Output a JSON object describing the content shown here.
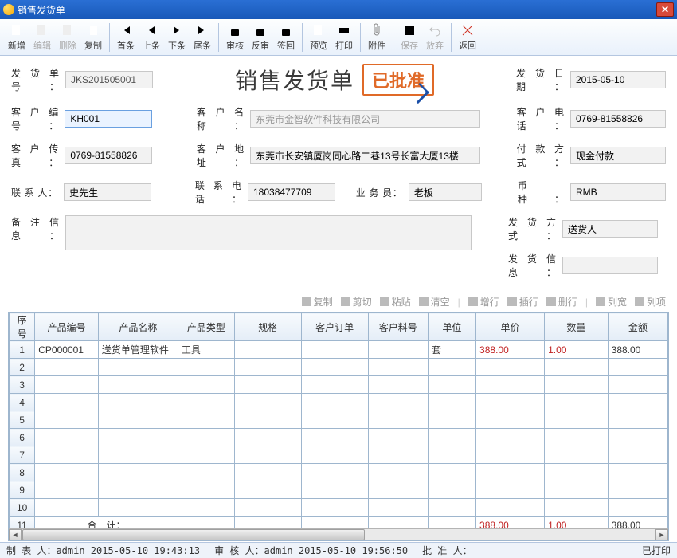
{
  "window": {
    "title": "销售发货单"
  },
  "toolbar": [
    {
      "name": "new",
      "label": "新增",
      "icon": "doc-plus",
      "color": "#4caf50"
    },
    {
      "name": "edit",
      "label": "编辑",
      "icon": "doc-pen",
      "color": "#b0a080",
      "dis": true
    },
    {
      "name": "delete",
      "label": "删除",
      "icon": "doc-x",
      "color": "#b0a080",
      "dis": true
    },
    {
      "name": "copy",
      "label": "复制",
      "icon": "docs",
      "color": "#b0a080"
    },
    {
      "sep": true
    },
    {
      "name": "first",
      "label": "首条",
      "icon": "first",
      "color": "#4a8fe0"
    },
    {
      "name": "prev",
      "label": "上条",
      "icon": "prev",
      "color": "#4a8fe0"
    },
    {
      "name": "next",
      "label": "下条",
      "icon": "next",
      "color": "#4a8fe0"
    },
    {
      "name": "last",
      "label": "尾条",
      "icon": "last",
      "color": "#4a8fe0"
    },
    {
      "sep": true
    },
    {
      "name": "audit",
      "label": "审核",
      "icon": "lock",
      "color": "#e0a030"
    },
    {
      "name": "unaudit",
      "label": "反审",
      "icon": "lock-open",
      "color": "#e0a030"
    },
    {
      "name": "sign",
      "label": "签回",
      "icon": "lock-green",
      "color": "#58b040"
    },
    {
      "sep": true
    },
    {
      "name": "preview",
      "label": "预览",
      "icon": "page-zoom",
      "color": "#888"
    },
    {
      "name": "print",
      "label": "打印",
      "icon": "printer",
      "color": "#888"
    },
    {
      "sep": true
    },
    {
      "name": "attach",
      "label": "附件",
      "icon": "clip",
      "color": "#888"
    },
    {
      "sep": true
    },
    {
      "name": "save",
      "label": "保存",
      "icon": "disk",
      "color": "#aaa",
      "dis": true
    },
    {
      "name": "discard",
      "label": "放弃",
      "icon": "undo",
      "color": "#aaa",
      "dis": true
    },
    {
      "sep": true
    },
    {
      "name": "return",
      "label": "返回",
      "icon": "x",
      "color": "#d03020"
    }
  ],
  "form": {
    "doc_no_label": "发货单号",
    "doc_no": "JKS201505001",
    "doc_title": "销售发货单",
    "stamp": "已批准",
    "date_label": "发货日期",
    "date": "2015-05-10",
    "cust_no_label": "客户编号",
    "cust_no": "KH001",
    "cust_name_label": "客户名称",
    "cust_name": "东莞市金智软件科技有限公司",
    "cust_tel_label": "客户电话",
    "cust_tel": "0769-81558826",
    "cust_fax_label": "客户传真",
    "cust_fax": "0769-81558826",
    "cust_addr_label": "客户地址",
    "cust_addr": "东莞市长安镇厦岗同心路二巷13号长富大厦13楼",
    "pay_label": "付款方式",
    "pay": "现金付款",
    "contact_label": "联 系 人",
    "contact": "史先生",
    "contact_tel_label": "联系电话",
    "contact_tel": "18038477709",
    "sales_label": "业 务 员",
    "sales": "老板",
    "currency_label": "币　　种",
    "currency": "RMB",
    "remark_label": "备注信息",
    "remark": "",
    "ship_way_label": "发货方式",
    "ship_way": "送货人",
    "ship_info_label": "发货信息",
    "ship_info": ""
  },
  "row_toolbar": [
    {
      "name": "copy",
      "label": "复制"
    },
    {
      "name": "cut",
      "label": "剪切"
    },
    {
      "name": "paste",
      "label": "粘贴"
    },
    {
      "name": "clear",
      "label": "清空"
    },
    {
      "sep": true
    },
    {
      "name": "addrow",
      "label": "增行"
    },
    {
      "name": "insrow",
      "label": "插行"
    },
    {
      "name": "delrow",
      "label": "删行"
    },
    {
      "sep": true
    },
    {
      "name": "colwidth",
      "label": "列宽"
    },
    {
      "name": "colitem",
      "label": "列项"
    }
  ],
  "grid": {
    "headers": [
      "序号",
      "产品编号",
      "产品名称",
      "产品类型",
      "规格",
      "客户订单",
      "客户料号",
      "单位",
      "单价",
      "数量",
      "金额"
    ],
    "rows": [
      {
        "n": "1",
        "code": "CP000001",
        "name": "送货单管理软件",
        "type": "工具",
        "spec": "",
        "order": "",
        "matno": "",
        "unit": "套",
        "price": "388.00",
        "qty": "1.00",
        "amt": "388.00"
      },
      {
        "n": "2"
      },
      {
        "n": "3"
      },
      {
        "n": "4"
      },
      {
        "n": "5"
      },
      {
        "n": "6"
      },
      {
        "n": "7"
      },
      {
        "n": "8"
      },
      {
        "n": "9"
      },
      {
        "n": "10"
      }
    ],
    "total": {
      "label": "合　计：",
      "price": "388.00",
      "qty": "1.00",
      "amt": "388.00",
      "n": "11"
    }
  },
  "status": {
    "maker_label": "制 表 人：",
    "maker": "admin 2015-05-10 19:43:13",
    "auditor_label": "审 核 人：",
    "auditor": "admin 2015-05-10 19:56:50",
    "approver_label": "批 准 人：",
    "approver": "",
    "printed": "已打印"
  }
}
